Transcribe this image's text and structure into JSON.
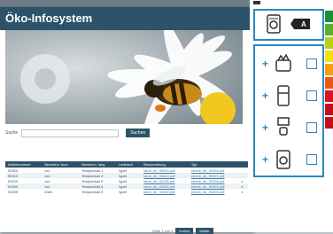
{
  "window": {
    "title": "Öko-Infosystem"
  },
  "search": {
    "label": "Suche",
    "value": "",
    "button": "Suchen"
  },
  "table": {
    "headers": [
      "Artikelnummer",
      "Bezeichn. kurz",
      "Bezeichn. lang",
      "Lieferant",
      "Beschreibung",
      "Typ"
    ],
    "rows": [
      [
        "90304",
        "xxx",
        "Testprodukt 1",
        "typet",
        "label_de_90304.pdf",
        "ebeek_de_90304.pdf",
        ""
      ],
      [
        "90413",
        "xxx",
        "Testprodukt 2",
        "typet",
        "label_de_90413.pdf",
        "ebeek_de_90413.pdf",
        ""
      ],
      [
        "90105",
        "xxx",
        "Testprodukt 3",
        "typet",
        "label_de_90105.pdf",
        "ebeek_de_90105.pdf",
        "x"
      ],
      [
        "90304",
        "xxx",
        "Testprodukt 4",
        "typet",
        "label_de_90304.pdf",
        "ebeek_de_90304.pdf",
        "x"
      ],
      [
        "90305",
        "insbl.",
        "Testprodukt 5",
        "typet",
        "label_de_90305.pdf",
        "ebeek_de_90305.pdf",
        "x"
      ]
    ]
  },
  "pager": {
    "info": "Seite 1 von 4",
    "back": "zurück",
    "next": "Weiter"
  },
  "panel": {
    "rows": [
      "cooler-icon",
      "fridge-icon",
      "coffee-machine-icon",
      "washer-icon"
    ],
    "energy_colors": [
      "#1b8f3a",
      "#5aaf32",
      "#b5cf1c",
      "#f2e40a",
      "#f5a00a",
      "#e85a14",
      "#d9141e",
      "#c40f18",
      "#c40f18"
    ]
  }
}
